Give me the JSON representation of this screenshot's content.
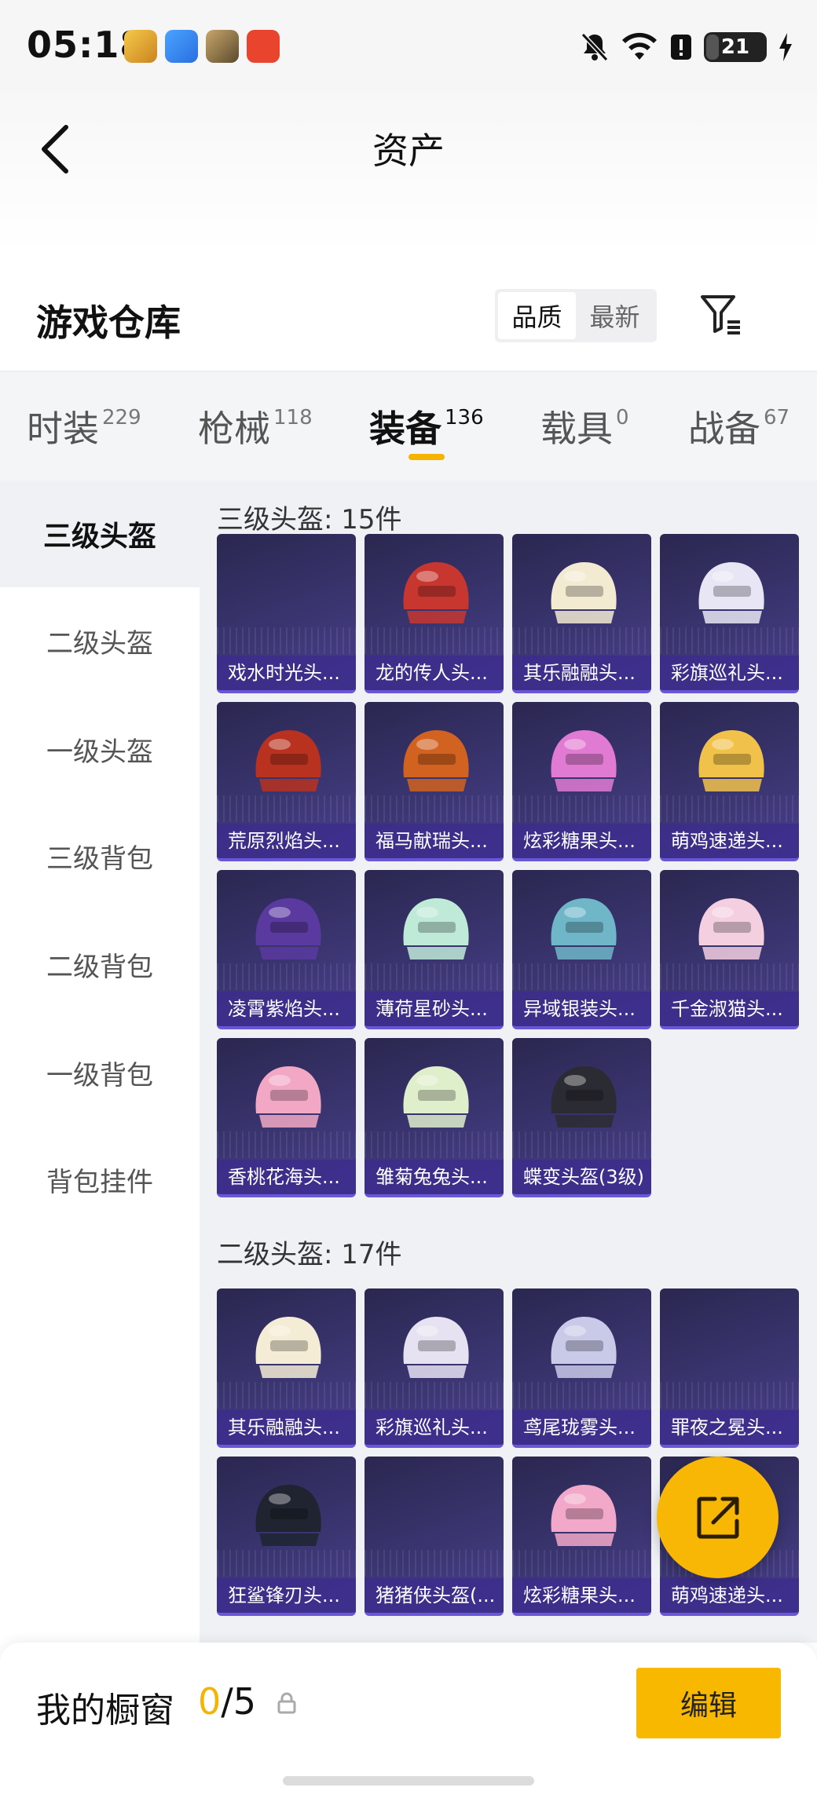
{
  "status_bar": {
    "time": "05:18",
    "battery": "21"
  },
  "header": {
    "title": "资产"
  },
  "warehouse": {
    "title": "游戏仓库",
    "sort_options": [
      "品质",
      "最新"
    ]
  },
  "tabs": [
    {
      "label": "时装",
      "count": "229"
    },
    {
      "label": "枪械",
      "count": "118"
    },
    {
      "label": "装备",
      "count": "136"
    },
    {
      "label": "载具",
      "count": "0"
    },
    {
      "label": "战备",
      "count": "67"
    }
  ],
  "sidebar": [
    "三级头盔",
    "二级头盔",
    "一级头盔",
    "三级背包",
    "二级背包",
    "一级背包",
    "背包挂件"
  ],
  "sections": [
    {
      "title": "三级头盔: 15件",
      "items": [
        {
          "label": "戏水时光头...",
          "color": ""
        },
        {
          "label": "龙的传人头...",
          "color": "#c8372f"
        },
        {
          "label": "其乐融融头...",
          "color": "#f3ead2"
        },
        {
          "label": "彩旗巡礼头...",
          "color": "#e8e6f4"
        },
        {
          "label": "荒原烈焰头...",
          "color": "#b8321f"
        },
        {
          "label": "福马献瑞头...",
          "color": "#d2621f"
        },
        {
          "label": "炫彩糖果头...",
          "color": "#e07ad2"
        },
        {
          "label": "萌鸡速递头...",
          "color": "#f1c24a"
        },
        {
          "label": "凌霄紫焰头...",
          "color": "#5b3aa0"
        },
        {
          "label": "薄荷星砂头...",
          "color": "#bfead8"
        },
        {
          "label": "异域银装头...",
          "color": "#6fb6c8"
        },
        {
          "label": "千金淑猫头...",
          "color": "#f3cfe0"
        },
        {
          "label": "香桃花海头...",
          "color": "#f2a8c4"
        },
        {
          "label": "雏菊兔兔头...",
          "color": "#dfeecb"
        },
        {
          "label": "蝶变头盔(3级)",
          "color": "#2b2b33"
        }
      ]
    },
    {
      "title": "二级头盔: 17件",
      "items": [
        {
          "label": "其乐融融头...",
          "color": "#f4ecd4"
        },
        {
          "label": "彩旗巡礼头...",
          "color": "#e6e2f2"
        },
        {
          "label": "鸢尾珑雾头...",
          "color": "#c9c9e8"
        },
        {
          "label": "罪夜之冕头...",
          "color": ""
        },
        {
          "label": "狂鲨锋刃头...",
          "color": "#1f2430"
        },
        {
          "label": "猪猪侠头盔(...",
          "color": ""
        },
        {
          "label": "炫彩糖果头...",
          "color": "#f2a8c8"
        },
        {
          "label": "萌鸡速递头...",
          "color": ""
        }
      ]
    }
  ],
  "bottom_bar": {
    "showcase_label": "我的橱窗",
    "showcase_current": "0",
    "showcase_total": "/5",
    "edit_label": "编辑"
  }
}
